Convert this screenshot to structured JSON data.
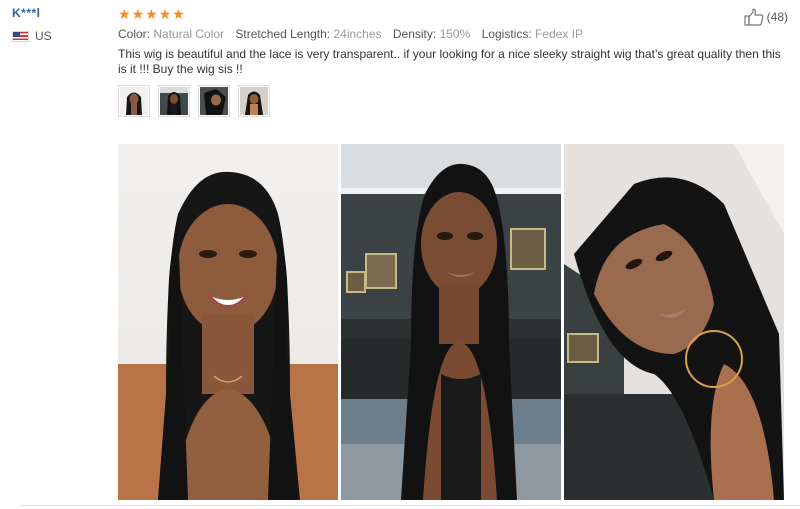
{
  "reviewer": {
    "name": "K***l",
    "country": "US",
    "flag_icon": "us-flag-icon"
  },
  "review": {
    "rating": 5,
    "rating_max": 5,
    "star_color": "#f68b1f",
    "likes": "(48)",
    "like_icon": "thumbs-up-icon",
    "attributes": [
      {
        "label": "Color:",
        "value": "Natural Color"
      },
      {
        "label": "Stretched Length:",
        "value": "24inches"
      },
      {
        "label": "Density:",
        "value": "150%"
      },
      {
        "label": "Logistics:",
        "value": "Fedex IP"
      }
    ],
    "text": "This wig is beautiful and the lace is very transparent.. if your looking for a nice sleeky straight wig that’s great quality then this is it !!! Buy the wig sis !!",
    "thumbnail_count": 4,
    "photo_count": 3
  },
  "colors": {
    "name_link": "#2a62b3",
    "hair": "#141414",
    "skin": "#8a5a40",
    "wall": "#3d4344"
  }
}
